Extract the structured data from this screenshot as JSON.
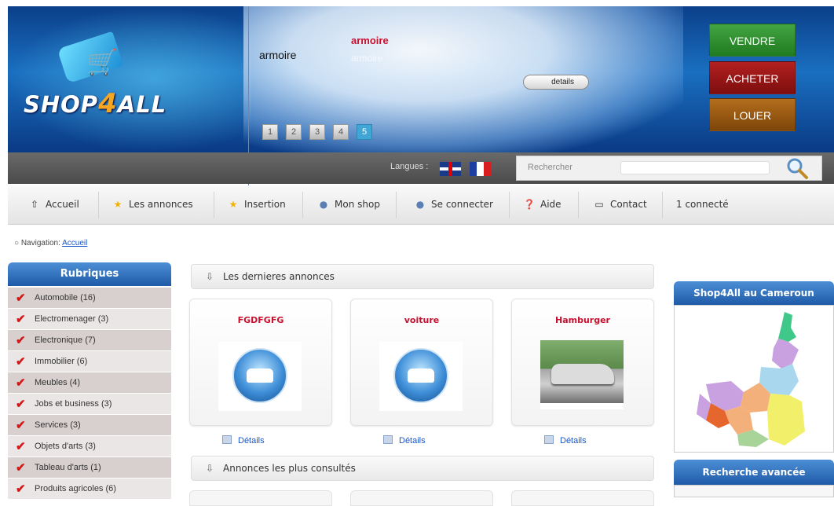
{
  "header": {
    "logo_text_1": "SHOP",
    "logo_text_2": "4",
    "logo_text_3": "ALL",
    "slide_title": "armoire",
    "slide_red": "armoire",
    "slide_sub": "armoire",
    "details_label": "details",
    "pages": [
      "1",
      "2",
      "3",
      "4",
      "5"
    ],
    "active_page": "5",
    "actions": {
      "sell": "VENDRE",
      "buy": "ACHETER",
      "rent": "LOUER"
    }
  },
  "bar": {
    "lang_label": "Langues :",
    "search_placeholder": "Rechercher"
  },
  "nav": {
    "items": [
      "Accueil",
      "Les annonces",
      "Insertion",
      "Mon shop",
      "Se connecter",
      "Aide",
      "Contact"
    ],
    "connected": "1 connecté"
  },
  "breadcrumb": {
    "label": "Navigation:",
    "link": "Accueil"
  },
  "sidebar": {
    "title": "Rubriques",
    "items": [
      "Automobile (16)",
      "Electromenager (3)",
      "Electronique (7)",
      "Immobilier (6)",
      "Meubles (4)",
      "Jobs et business (3)",
      "Services (3)",
      "Objets d'arts (3)",
      "Tableau d'arts (1)",
      "Produits agricoles (6)"
    ]
  },
  "main": {
    "latest_title": "Les dernieres annonces",
    "latest": [
      {
        "title": "FGDFGFG",
        "link": "Détails",
        "image": "car-icon"
      },
      {
        "title": "voiture",
        "link": "Détails",
        "image": "car-icon"
      },
      {
        "title": "Hamburger",
        "link": "Détails",
        "image": "car-photo"
      }
    ],
    "popular_title": "Annonces les plus consultés"
  },
  "right": {
    "map_title": "Shop4All au Cameroun",
    "advanced_title": "Recherche avancée"
  },
  "colors": {
    "accent_red": "#c8102e",
    "link_blue": "#1a55c8",
    "panel_blue": "#1f5aa8",
    "sell": "#2e8f2e",
    "buy": "#9a1717",
    "rent": "#9b5a12"
  }
}
